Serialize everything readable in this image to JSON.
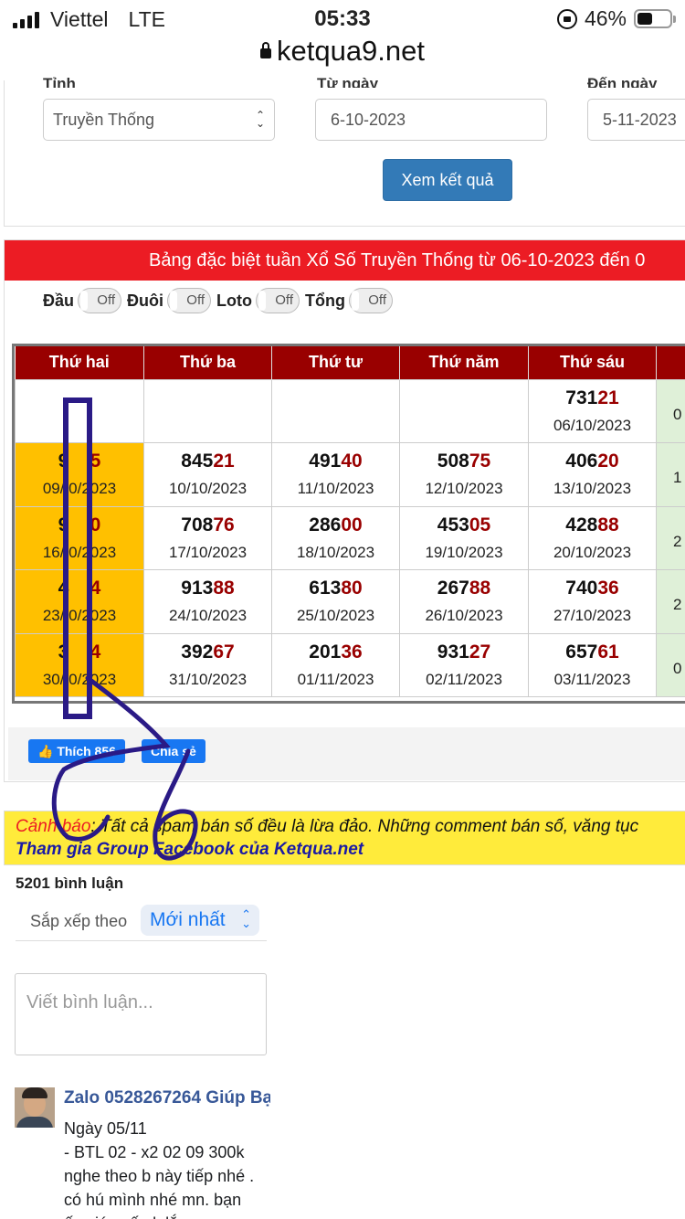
{
  "status_bar": {
    "carrier": "Viettel",
    "network": "LTE",
    "time": "05:33",
    "battery": "46%"
  },
  "browser": {
    "url": "ketqua9.net"
  },
  "filter": {
    "province_label": "Tỉnh",
    "province_value": "Truyền Thống",
    "from_label": "Từ ngày",
    "from_value": "6-10-2023",
    "to_label": "Đến ngày",
    "to_value": "5-11-2023",
    "submit_label": "Xem kết quả"
  },
  "results": {
    "title": "Bảng đặc biệt tuần Xổ Số Truyền Thống từ 06-10-2023 đến 0",
    "toggles": [
      {
        "label": "Đầu",
        "state": "Off"
      },
      {
        "label": "Đuôi",
        "state": "Off"
      },
      {
        "label": "Loto",
        "state": "Off"
      },
      {
        "label": "Tổng",
        "state": "Off"
      }
    ],
    "days": [
      "Thứ hai",
      "Thứ ba",
      "Thứ tư",
      "Thứ năm",
      "Thứ sáu",
      ""
    ],
    "rows": [
      [
        {
          "pre": "",
          "hi": "",
          "date": ""
        },
        {
          "pre": "",
          "hi": "",
          "date": ""
        },
        {
          "pre": "",
          "hi": "",
          "date": ""
        },
        {
          "pre": "",
          "hi": "",
          "date": ""
        },
        {
          "pre": "731",
          "hi": "21",
          "date": "06/10/2023"
        },
        {
          "pre": "",
          "hi": "",
          "date": "0"
        }
      ],
      [
        {
          "pre": "9",
          "hi": "5",
          "date": "09/ 0/2023"
        },
        {
          "pre": "845",
          "hi": "21",
          "date": "10/10/2023"
        },
        {
          "pre": "491",
          "hi": "40",
          "date": "11/10/2023"
        },
        {
          "pre": "508",
          "hi": "75",
          "date": "12/10/2023"
        },
        {
          "pre": "406",
          "hi": "20",
          "date": "13/10/2023"
        },
        {
          "pre": "",
          "hi": "",
          "date": "1"
        }
      ],
      [
        {
          "pre": "9",
          "hi": "0",
          "date": "16/ 0/2023"
        },
        {
          "pre": "708",
          "hi": "76",
          "date": "17/10/2023"
        },
        {
          "pre": "286",
          "hi": "00",
          "date": "18/10/2023"
        },
        {
          "pre": "453",
          "hi": "05",
          "date": "19/10/2023"
        },
        {
          "pre": "428",
          "hi": "88",
          "date": "20/10/2023"
        },
        {
          "pre": "",
          "hi": "",
          "date": "2"
        }
      ],
      [
        {
          "pre": "4",
          "hi": "4",
          "date": "23/ 0/2023"
        },
        {
          "pre": "913",
          "hi": "88",
          "date": "24/10/2023"
        },
        {
          "pre": "613",
          "hi": "80",
          "date": "25/10/2023"
        },
        {
          "pre": "267",
          "hi": "88",
          "date": "26/10/2023"
        },
        {
          "pre": "740",
          "hi": "36",
          "date": "27/10/2023"
        },
        {
          "pre": "",
          "hi": "",
          "date": "2"
        }
      ],
      [
        {
          "pre": "3",
          "hi": "4",
          "date": "30/ 0/2023"
        },
        {
          "pre": "392",
          "hi": "67",
          "date": "31/10/2023"
        },
        {
          "pre": "201",
          "hi": "36",
          "date": "01/11/2023"
        },
        {
          "pre": "931",
          "hi": "27",
          "date": "02/11/2023"
        },
        {
          "pre": "657",
          "hi": "61",
          "date": "03/11/2023"
        },
        {
          "pre": "",
          "hi": "",
          "date": "0"
        }
      ]
    ],
    "like_label": "Thích 856",
    "share_label": "Chia sẻ"
  },
  "warning": {
    "prefix": "Cảnh báo",
    "text": ": Tất cả spam bán số đều là lừa đảo. Những comment bán số, văng tục",
    "group_link": "Tham gia Group Facebook của Ketqua.net"
  },
  "comments": {
    "count_label": "5201 bình luận",
    "sort_label": "Sắp xếp theo",
    "sort_value": "Mới nhất",
    "input_placeholder": "Viết bình luận...",
    "items": [
      {
        "author": "Zalo 0528267264 Giúp Bạ",
        "lines": [
          "Ngày 05/11",
          "- BTL 02 - x2 02 09 300k",
          "nghe theo b này tiếp nhé .",
          "có hú mình nhé mn. bạn",
          "ấy giúp số ok lắm"
        ]
      }
    ]
  },
  "colors": {
    "header_red": "#ec1c24",
    "table_head": "#990000",
    "monday_bg": "#ffc000",
    "button_blue": "#337ab7",
    "annotation": "#2a1a86"
  }
}
